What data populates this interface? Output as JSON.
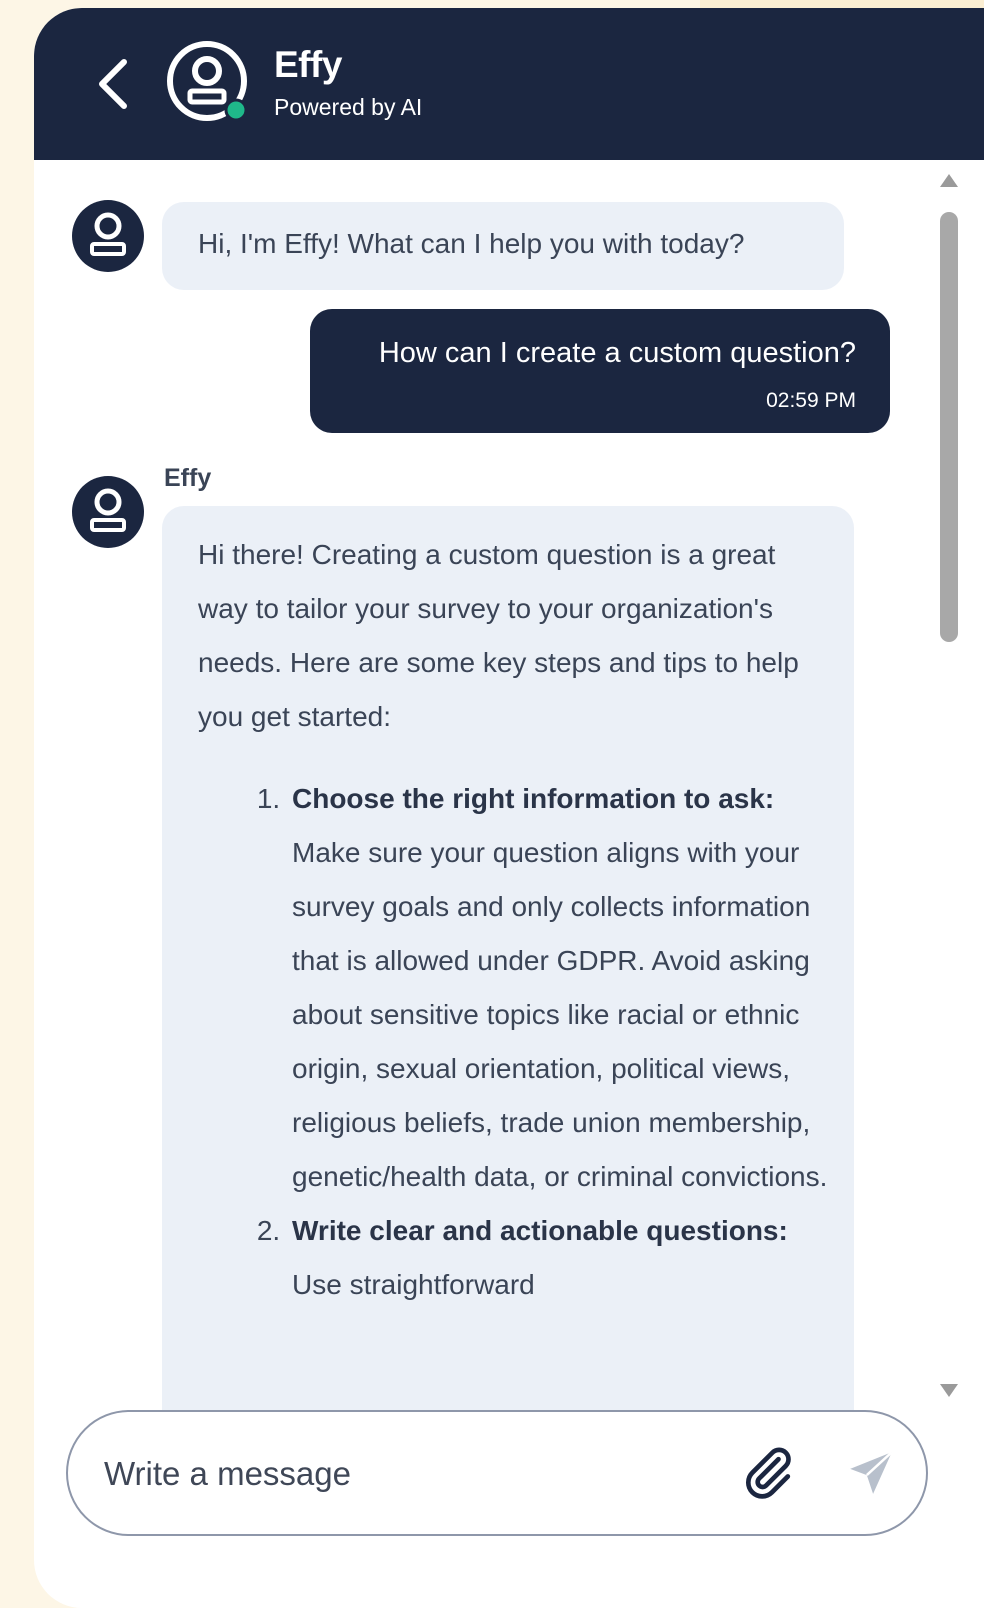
{
  "header": {
    "title": "Effy",
    "subtitle": "Powered by AI"
  },
  "conversation": {
    "greeting": "Hi, I'm Effy! What can I help you with today?",
    "user_message": {
      "text": "How can I create a custom question?",
      "timestamp": "02:59 PM"
    },
    "reply": {
      "sender": "Effy",
      "intro": "Hi there! Creating a custom question is a great way to tailor your survey to your organization's needs. Here are some key steps and tips to help you get started:",
      "steps": [
        {
          "title": "Choose the right information to ask:",
          "text": "Make sure your question aligns with your survey goals and only collects information that is allowed under GDPR. Avoid asking about sensitive topics like racial or ethnic origin, sexual orientation, political views, religious beliefs, trade union membership, genetic/health data, or criminal convictions."
        },
        {
          "title": "Write clear and actionable questions:",
          "text": "Use straightforward"
        }
      ]
    }
  },
  "composer": {
    "placeholder": "Write a message"
  },
  "colors": {
    "header_bg": "#1b2640",
    "bot_bubble": "#ebf0f7",
    "user_bubble": "#1b2640",
    "online_indicator": "#1fb88a",
    "page_bg": "#fdf6e6"
  },
  "icons": {
    "back": "chevron-left-icon",
    "avatar": "bot-avatar-icon",
    "status": "online-dot-icon",
    "attach": "paperclip-icon",
    "send": "send-arrow-icon"
  }
}
